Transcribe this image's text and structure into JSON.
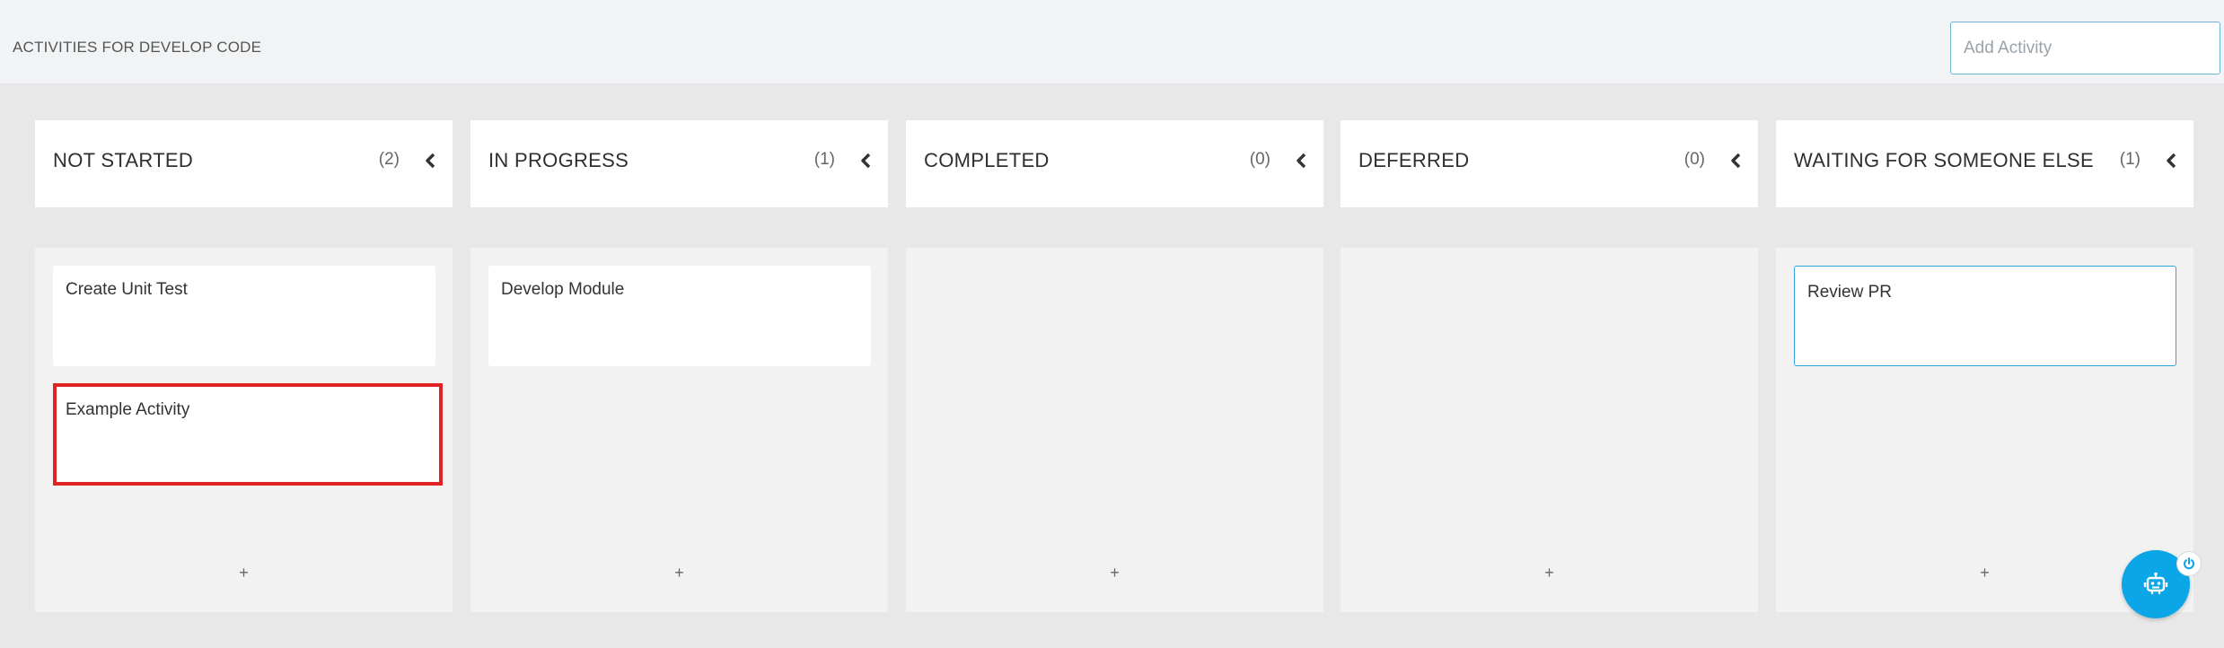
{
  "header": {
    "title": "ACTIVITIES FOR DEVELOP CODE",
    "add_placeholder": "Add Activity"
  },
  "columns": [
    {
      "title": "NOT STARTED",
      "count": "(2)",
      "add_label": "+",
      "cards": [
        "Create Unit Test",
        "Example Activity"
      ]
    },
    {
      "title": "IN PROGRESS",
      "count": "(1)",
      "add_label": "+",
      "cards": [
        "Develop Module"
      ]
    },
    {
      "title": "COMPLETED",
      "count": "(0)",
      "add_label": "+",
      "cards": []
    },
    {
      "title": "DEFERRED",
      "count": "(0)",
      "add_label": "+",
      "cards": []
    },
    {
      "title": "WAITING FOR SOMEONE ELSE",
      "count": "(1)",
      "add_label": "+",
      "cards": [
        "Review PR"
      ]
    }
  ],
  "icons": {
    "collapse": "chevron-left-icon",
    "assistant": "robot-icon",
    "power": "power-icon"
  },
  "colors": {
    "accent": "#0aa6e8",
    "selected_border": "#e02424",
    "focus_border": "#2fa3e0"
  }
}
